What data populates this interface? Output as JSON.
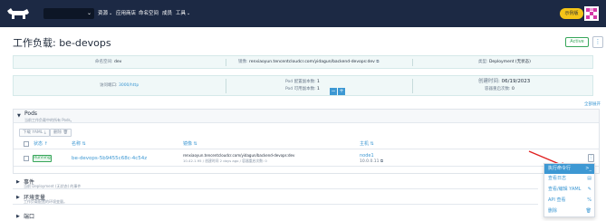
{
  "nav": {
    "items": [
      {
        "label": "资源",
        "has_chevron": true
      },
      {
        "label": "应用商店",
        "has_chevron": false
      },
      {
        "label": "命名空间",
        "has_chevron": false
      },
      {
        "label": "成员",
        "has_chevron": false
      },
      {
        "label": "工具",
        "has_chevron": true
      }
    ],
    "badge_label": "示例版",
    "colors": {
      "bg": "#1c2944",
      "accent": "#f5c518"
    }
  },
  "header": {
    "title": "工作负载: be-devops",
    "status": "Active",
    "more": "⋮"
  },
  "info": {
    "namespace_label": "命名空间:",
    "namespace_value": "dev",
    "image_label": "镜像:",
    "image_value": "renxiaoyun.tencentcloudcr.com/yidagun/backend-devops:dev",
    "type_label": "类型:",
    "type_value": "Deployment (无状态)",
    "workload_label": "访问端口:",
    "workload_value": "3000/http",
    "pods_scale_label": "Pod 配置副本数:",
    "pods_scale_value": "1",
    "pods_ready_label": "Pod 可用副本数:",
    "pods_ready_value": "1",
    "created_label": "创建时间:",
    "created_value": "06/19/2023",
    "restart_label": "容器重启次数:",
    "restart_value": "0"
  },
  "expand_all": "全部展开",
  "pods": {
    "title": "Pods",
    "subtitle": "当前工作负载中的所有 Pods。",
    "download_yaml": "下载 YAML",
    "delete": "删除",
    "columns": {
      "state": "状态",
      "name": "名称",
      "image": "镜像",
      "node": "主机"
    },
    "rows": [
      {
        "state": "Running",
        "name": "be-devops-5b9455c68c-4c54z",
        "image": "renxiaoyun.tencentcloudcr.com/yidagun/backend-devops:dev",
        "image_meta": "10.42.1.95 / 创建时间 2 days ago / 容器重启次数: 0",
        "node": "node1",
        "node_ip": "10.0.0.11"
      }
    ]
  },
  "sections": [
    {
      "title": "事件",
      "subtitle": "当前 Deployment (无状态) 的事件"
    },
    {
      "title": "环境变量",
      "subtitle": "工作负载配置的环境变量。"
    },
    {
      "title": "端口",
      "subtitle": ""
    }
  ],
  "menu": {
    "items": [
      {
        "label": "执行命令行",
        "icon": "terminal-icon",
        "glyph": ">_",
        "active": true
      },
      {
        "label": "查看日志",
        "icon": "file-icon",
        "glyph": "▤",
        "active": false
      },
      {
        "label": "查看/编辑 YAML",
        "icon": "edit-icon",
        "glyph": "✎",
        "active": false
      },
      {
        "label": "API 查看",
        "icon": "api-icon",
        "glyph": "%",
        "active": false
      },
      {
        "label": "删除",
        "icon": "trash-icon",
        "glyph": "🗑",
        "active": false
      }
    ]
  }
}
